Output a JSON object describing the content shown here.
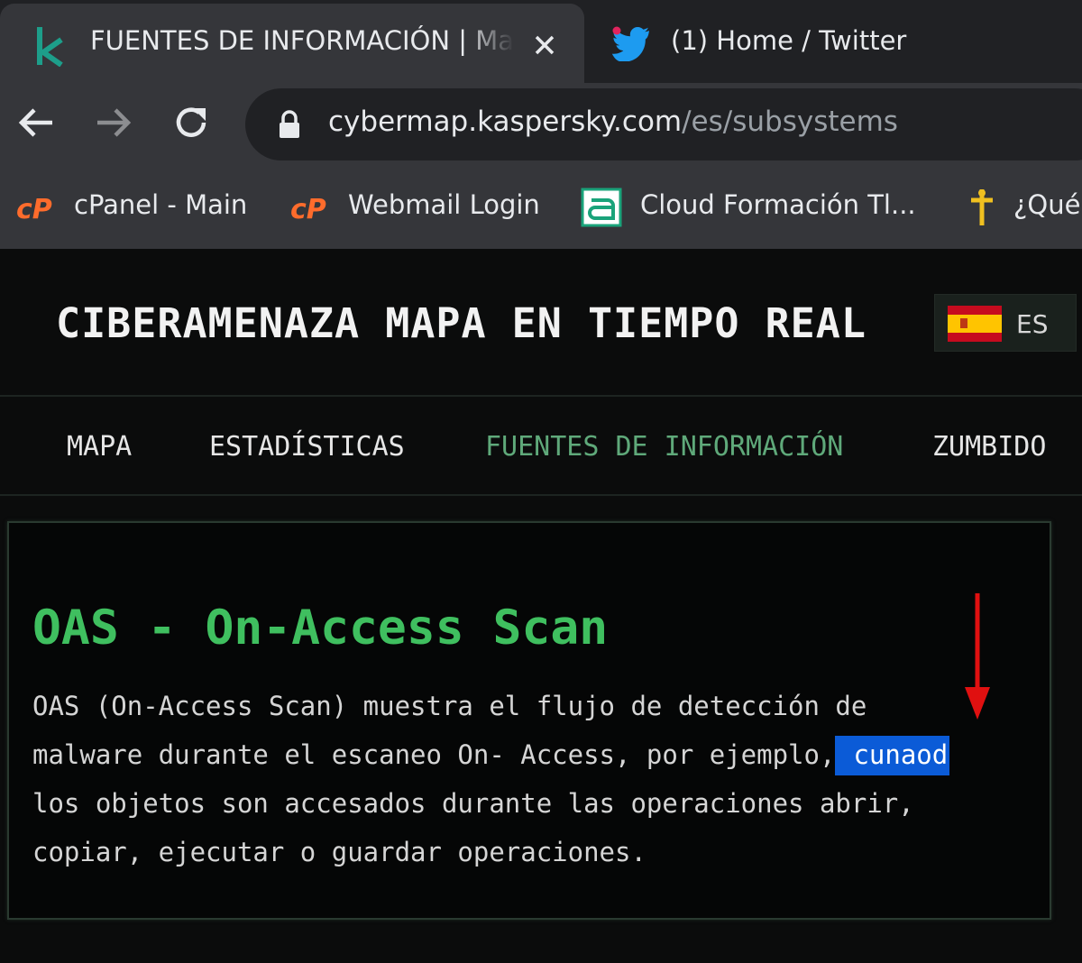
{
  "browser": {
    "tabs": [
      {
        "title": "FUENTES DE INFORMACIÓN | Mapa",
        "active": true,
        "favicon": "kaspersky-k-icon"
      },
      {
        "title": "(1) Home / Twitter",
        "active": false,
        "favicon": "twitter-bird-icon"
      }
    ],
    "url": {
      "host": "cybermap.kaspersky.com",
      "path": "/es/subsystems"
    },
    "bookmarks": [
      {
        "label": "cPanel - Main",
        "icon": "cpanel-icon"
      },
      {
        "label": "Webmail Login",
        "icon": "cpanel-icon"
      },
      {
        "label": "Cloud Formación Tl...",
        "icon": "cloud-formacion-icon"
      },
      {
        "label": "¿Qué",
        "icon": "cross-icon"
      }
    ]
  },
  "site": {
    "title": "CIBERAMENAZA MAPA EN TIEMPO REAL",
    "language": "ES",
    "nav": [
      {
        "label": "MAPA",
        "active": false
      },
      {
        "label": "ESTADÍSTICAS",
        "active": false
      },
      {
        "label": "FUENTES DE INFORMACIÓN",
        "active": true
      },
      {
        "label": "ZUMBIDO",
        "active": false
      }
    ]
  },
  "content": {
    "heading": "OAS - On-Access Scan",
    "lines": [
      "OAS (On-Access Scan) muestra el flujo de detección de",
      "malware durante el escaneo On- Access, por ejemplo,",
      "los objetos son accesados durante las operaciones abrir,",
      "copiar, ejecutar o guardar operaciones."
    ],
    "highlighted_word": "cunaod"
  },
  "colors": {
    "accent_green": "#3fbf5f",
    "nav_active": "#5fa97a",
    "highlight": "#0b5bd7",
    "annotation_arrow": "#e01010"
  }
}
